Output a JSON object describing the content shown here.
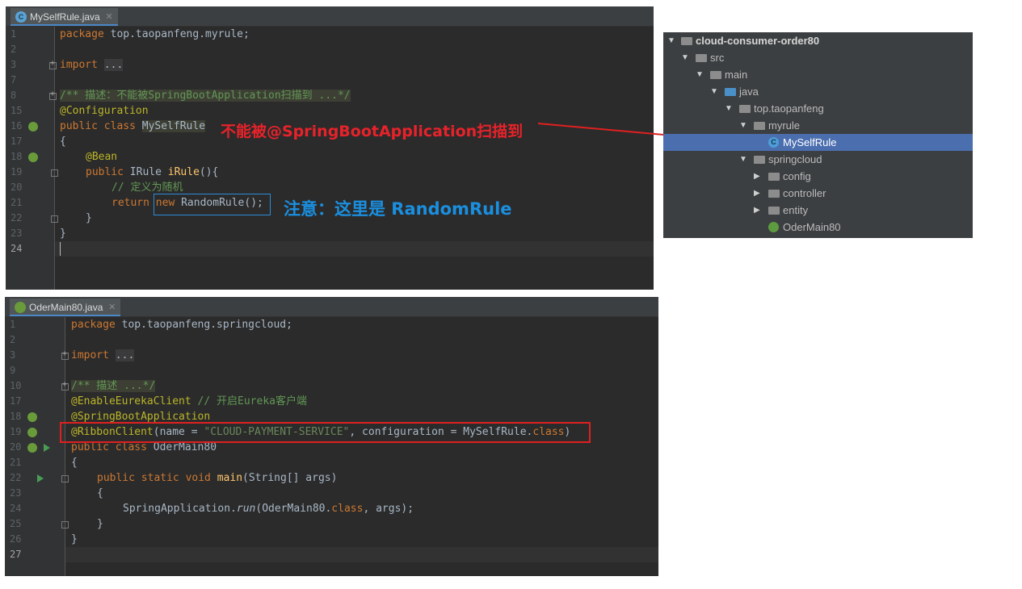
{
  "top_editor": {
    "tab_label": "MySelfRule.java",
    "tab_icon": "C",
    "line_numbers": [
      "1",
      "2",
      "3",
      "7",
      "8",
      "15",
      "16",
      "17",
      "18",
      "19",
      "20",
      "21",
      "22",
      "23",
      "24"
    ],
    "code": {
      "l1_kw": "package",
      "l1_rest": " top.taopanfeng.myrule;",
      "l3_kw": "import",
      "l3_fold": "...",
      "l8_comment": "/** 描述：不能被SpringBootApplication扫描到 ...*/",
      "l15_ann": "@Configuration",
      "l16_kw": "public class",
      "l16_name": "MySelfRule",
      "l17": "{",
      "l18_ann": "@Bean",
      "l19_kw": "public",
      "l19_type": " IRule ",
      "l19_fn": "iRule",
      "l19_rest": "(){",
      "l20_comment": "// 定义为随机",
      "l21_kw": "return",
      "l21_new": "new",
      "l21_rest": " RandomRule();",
      "l22": "}",
      "l23": "}"
    },
    "note_red": "不能被@SpringBootApplication扫描到",
    "note_blue": "注意：这里是 RandomRule"
  },
  "project_tree": {
    "items": [
      {
        "label": "cloud-consumer-order80"
      },
      {
        "label": "src"
      },
      {
        "label": "main"
      },
      {
        "label": "java"
      },
      {
        "label": "top.taopanfeng"
      },
      {
        "label": "myrule"
      },
      {
        "label": "MySelfRule"
      },
      {
        "label": "springcloud"
      },
      {
        "label": "config"
      },
      {
        "label": "controller"
      },
      {
        "label": "entity"
      },
      {
        "label": "OderMain80"
      }
    ],
    "class_icon": "C"
  },
  "bottom_editor": {
    "tab_label": "OderMain80.java",
    "line_numbers": [
      "1",
      "2",
      "3",
      "9",
      "10",
      "17",
      "18",
      "19",
      "20",
      "21",
      "22",
      "23",
      "24",
      "25",
      "26",
      "27"
    ],
    "code": {
      "l1_kw": "package",
      "l1_rest": " top.taopanfeng.springcloud;",
      "l3_kw": "import",
      "l3_fold": "...",
      "l10_comment": "/** 描述 ...*/",
      "l17_ann": "@EnableEurekaClient",
      "l17_comment": " // 开启Eureka客户端",
      "l18_ann": "@SpringBootApplication",
      "l19_ann": "@RibbonClient",
      "l19_a": "(name = ",
      "l19_str": "\"CLOUD-PAYMENT-SERVICE\"",
      "l19_b": ", configuration = MySelfRule.",
      "l19_cls": "class",
      "l19_c": ")",
      "l20_kw": "public class",
      "l20_rest": " OderMain80",
      "l21": "{",
      "l22_kw": "public static void",
      "l22_fn": " main",
      "l22_rest": "(String[] args)",
      "l23": "{",
      "l24_a": "SpringApplication.",
      "l24_run": "run",
      "l24_b": "(OderMain80.",
      "l24_cls": "class",
      "l24_c": ", args);",
      "l25": "}",
      "l26": "}"
    }
  }
}
